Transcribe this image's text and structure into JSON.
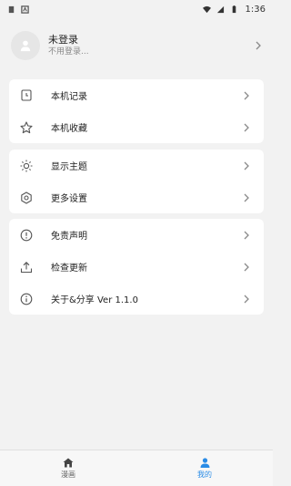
{
  "status_bar": {
    "time": "1:36"
  },
  "profile": {
    "name": "未登录",
    "subtitle": "不用登录..."
  },
  "menu_group_1": [
    {
      "label": "本机记录",
      "icon": "history-doc-icon"
    },
    {
      "label": "本机收藏",
      "icon": "star-icon"
    }
  ],
  "menu_group_2": [
    {
      "label": "显示主题",
      "icon": "sun-icon"
    },
    {
      "label": "更多设置",
      "icon": "settings-hex-icon"
    }
  ],
  "menu_group_3": [
    {
      "label": "免责声明",
      "icon": "alert-circle-icon"
    },
    {
      "label": "检查更新",
      "icon": "upload-icon"
    },
    {
      "label": "关于&分享 Ver 1.1.0",
      "icon": "info-circle-icon"
    }
  ],
  "bottom_nav": {
    "tabs": [
      {
        "label": "漫画",
        "icon": "home-icon",
        "active": false
      },
      {
        "label": "我的",
        "icon": "person-icon",
        "active": true
      }
    ]
  },
  "colors": {
    "accent": "#2a8ce6",
    "background": "#f2f2f2",
    "card": "#ffffff"
  }
}
